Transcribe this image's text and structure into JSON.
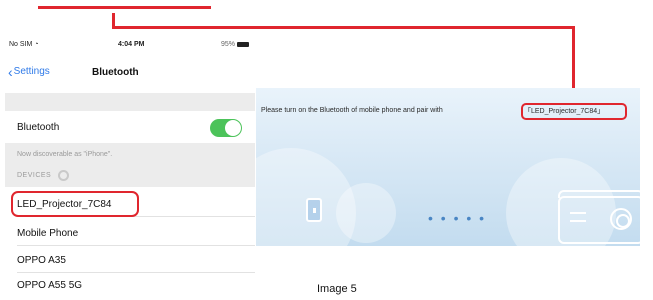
{
  "colors": {
    "callout": "#e0262e",
    "toggle_on": "#4cc35a",
    "ios_blue": "#2f7ae8"
  },
  "phone": {
    "status": {
      "carrier": "No SIM",
      "time": "4:04 PM",
      "battery": "95%"
    },
    "nav": {
      "back_label": "Settings",
      "title": "Bluetooth"
    },
    "bluetooth_row": {
      "label": "Bluetooth",
      "toggle_on": true
    },
    "discoverable_note": "Now discoverable as \"iPhone\".",
    "devices_header": "DEVICES",
    "devices": [
      {
        "name": "LED_Projector_7C84"
      },
      {
        "name": "Mobile Phone"
      },
      {
        "name": "OPPO A35"
      },
      {
        "name": "OPPO A55 5G"
      }
    ]
  },
  "projector_screen": {
    "message": "Please turn on the Bluetooth of mobile phone and pair with",
    "device_name": "「LED_Projector_7C84」",
    "icons": [
      "phone-icon",
      "dots-icon",
      "projector-icon"
    ],
    "dots": "• • • • •"
  },
  "caption": "Image 5"
}
